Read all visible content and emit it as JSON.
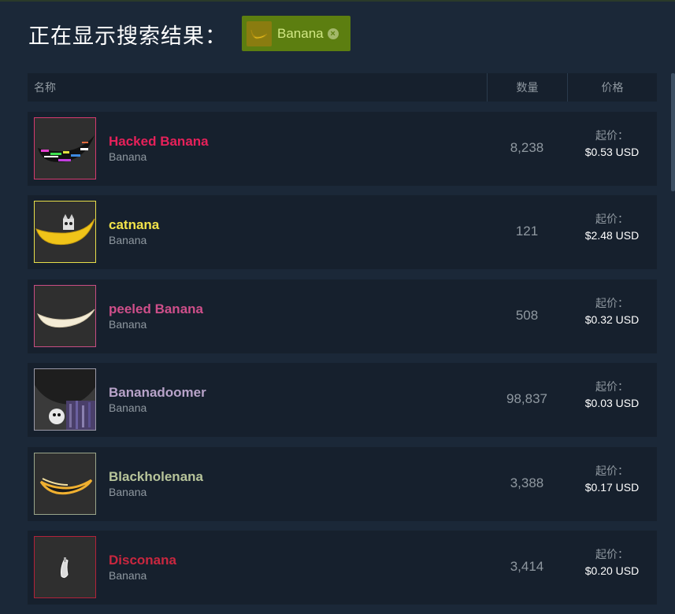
{
  "header": {
    "title": "正在显示搜索结果：",
    "filter_label": "Banana"
  },
  "table": {
    "col_name": "名称",
    "col_qty": "数量",
    "col_price": "价格"
  },
  "rows": [
    {
      "name": "Hacked Banana",
      "game": "Banana",
      "qty": "8,238",
      "price_label": "起价：",
      "price": "$0.53 USD",
      "name_color": "#e6215a",
      "border_color": "#d63a6e"
    },
    {
      "name": "catnana",
      "game": "Banana",
      "qty": "121",
      "price_label": "起价：",
      "price": "$2.48 USD",
      "name_color": "#f2e34a",
      "border_color": "#e8df4a"
    },
    {
      "name": "peeled Banana",
      "game": "Banana",
      "qty": "508",
      "price_label": "起价：",
      "price": "$0.32 USD",
      "name_color": "#cf4f8a",
      "border_color": "#c94d83"
    },
    {
      "name": "Bananadoomer",
      "game": "Banana",
      "qty": "98,837",
      "price_label": "起价：",
      "price": "$0.03 USD",
      "name_color": "#b8a3c9",
      "border_color": "#9a9aa8"
    },
    {
      "name": "Blackholenana",
      "game": "Banana",
      "qty": "3,388",
      "price_label": "起价：",
      "price": "$0.17 USD",
      "name_color": "#b7c49a",
      "border_color": "#9aa58a"
    },
    {
      "name": "Disconana",
      "game": "Banana",
      "qty": "3,414",
      "price_label": "起价：",
      "price": "$0.20 USD",
      "name_color": "#c9273f",
      "border_color": "#b3223a"
    }
  ]
}
